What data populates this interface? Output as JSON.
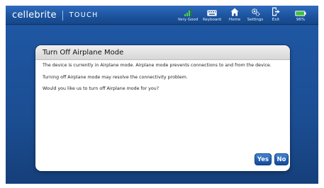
{
  "header": {
    "brand_name": "cellebrite",
    "brand_product": "TOUCH"
  },
  "toolbar": {
    "signal_label": "Very Good",
    "keyboard_label": "Keyboard",
    "home_label": "Home",
    "settings_label": "Settings",
    "exit_label": "Exit",
    "battery_label": "96%",
    "battery_level": 0.96
  },
  "dialog": {
    "title": "Turn Off Airplane Mode",
    "paragraph_1": "The device is currently in Airplane mode. Airplane mode prevents connections to and from the device.",
    "paragraph_2": "Turning off Airplane mode may resolve the connectivity problem.",
    "paragraph_3": "Would you like us to turn off Airplane mode for you?",
    "yes_label": "Yes",
    "no_label": "No"
  },
  "colors": {
    "background": "#1d4f96",
    "button": "#1e5fb4",
    "battery": "#3fbf3f"
  }
}
